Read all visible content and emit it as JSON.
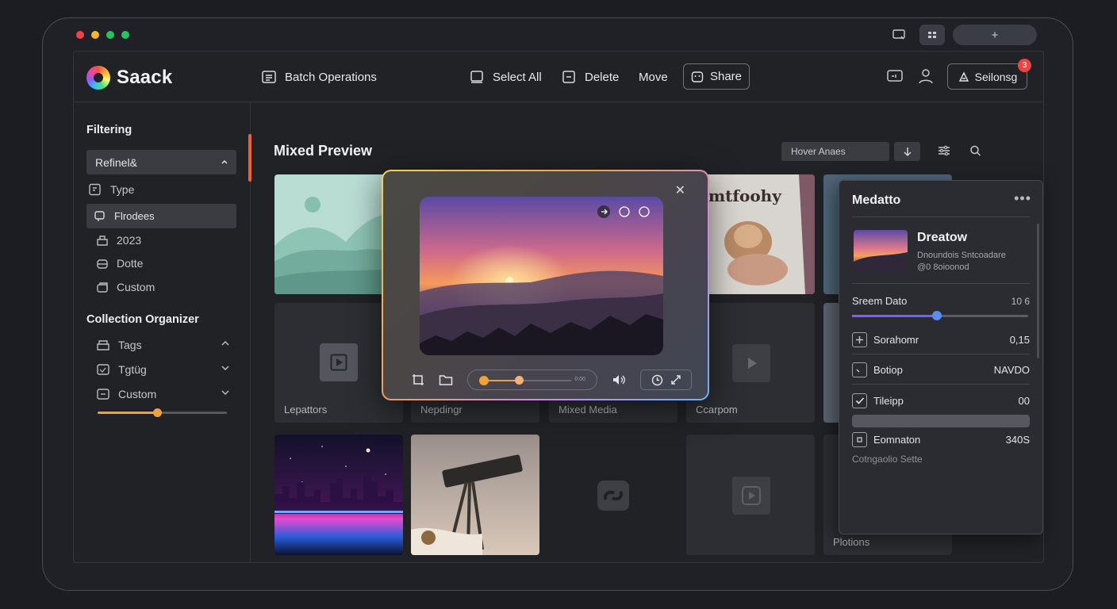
{
  "app": {
    "name": "Saack"
  },
  "header": {
    "batch_label": "Batch Operations",
    "select_all_label": "Select All",
    "delete_label": "Delete",
    "move_label": "Move",
    "share_label": "Share",
    "settings_label": "Seilonsg",
    "notification_count": "3"
  },
  "sidebar": {
    "filtering_title": "Filtering",
    "refine_label": "Refinel&",
    "items": [
      {
        "label": "Type",
        "icon": "file-icon"
      },
      {
        "label": "Flrodees",
        "icon": "tag-icon"
      },
      {
        "label": "2023",
        "icon": "folder-icon"
      },
      {
        "label": "Dotte",
        "icon": "stack-icon"
      },
      {
        "label": "Custom",
        "icon": "layers-icon"
      }
    ],
    "collection_title": "Collection Organizer",
    "collection_items": [
      {
        "label": "Tags",
        "icon": "tag-icon"
      },
      {
        "label": "Tgtüg",
        "icon": "image-icon"
      },
      {
        "label": "Custom",
        "icon": "box-icon"
      }
    ],
    "slider_value": 0.46
  },
  "main": {
    "title": "Mixed Preview",
    "filter_value": "Hover Anaes",
    "tiles": [
      {
        "caption": ""
      },
      {
        "caption": "Lepattors"
      },
      {
        "caption": "Nepdingr"
      },
      {
        "caption": "Mixed Media"
      },
      {
        "caption": "Ccarpom"
      },
      {
        "caption": "Plotions"
      }
    ],
    "tshirt_text": "mtfoohy"
  },
  "overlay": {
    "time_label": "0:00",
    "progress": 0.4
  },
  "panel": {
    "title": "Medatto",
    "item_name": "Dreatow",
    "item_sub1": "Dnoundois Sntcoadare",
    "item_sub2": "@0 8oioonod",
    "slider_label": "Sreem Dato",
    "slider_value": "10 6",
    "slider_fraction": 0.48,
    "rows": [
      {
        "label": "Sorahomr",
        "value": "0,15"
      },
      {
        "label": "Botiop",
        "value": "NAVDO"
      },
      {
        "label": "Tileipp",
        "value": "00"
      },
      {
        "label": "Eomnaton",
        "value": "340S"
      }
    ],
    "footer": "Cotngaolio Sette"
  },
  "colors": {
    "accent_orange": "#f0612e",
    "slider_orange": "#f0a13a",
    "panel_slider": "#5b8def"
  }
}
